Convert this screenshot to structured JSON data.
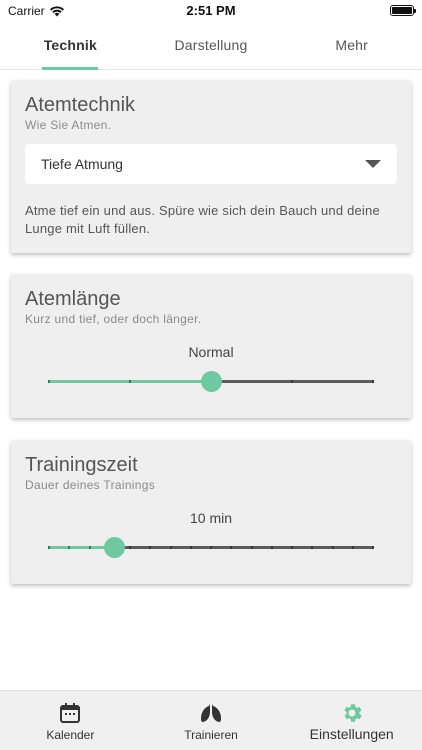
{
  "status_bar": {
    "carrier": "Carrier",
    "time": "2:51 PM"
  },
  "tabs": [
    {
      "label": "Technik",
      "active": true
    },
    {
      "label": "Darstellung",
      "active": false
    },
    {
      "label": "Mehr",
      "active": false
    }
  ],
  "atemtechnik": {
    "title": "Atemtechnik",
    "subtitle": "Wie Sie Atmen.",
    "selected": "Tiefe Atmung",
    "description": "Atme tief ein und aus. Spüre wie sich dein Bauch und deine Lunge mit Luft füllen."
  },
  "atemlaenge": {
    "title": "Atemlänge",
    "subtitle": "Kurz und tief, oder doch länger.",
    "value_label": "Normal",
    "position": 0.5,
    "steps": 4
  },
  "trainingszeit": {
    "title": "Trainingszeit",
    "subtitle": "Dauer deines Trainings",
    "value_label": "10 min",
    "position": 0.2,
    "steps": 16
  },
  "bottom_nav": [
    {
      "label": "Kalender",
      "icon": "calendar-icon",
      "active": false
    },
    {
      "label": "Trainieren",
      "icon": "lungs-icon",
      "active": false
    },
    {
      "label": "Einstellungen",
      "icon": "gear-icon",
      "active": true
    }
  ],
  "colors": {
    "accent": "#6ec8a0",
    "track": "#5c5c5c",
    "card": "#efefef"
  }
}
